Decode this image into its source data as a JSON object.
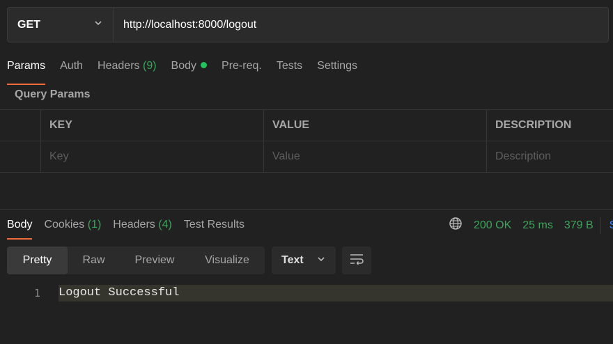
{
  "request": {
    "method": "GET",
    "url": "http://localhost:8000/logout"
  },
  "request_tabs": [
    {
      "label": "Params",
      "active": true
    },
    {
      "label": "Auth"
    },
    {
      "label": "Headers",
      "count": "(9)"
    },
    {
      "label": "Body",
      "dot": true
    },
    {
      "label": "Pre-req."
    },
    {
      "label": "Tests"
    },
    {
      "label": "Settings"
    }
  ],
  "query_params": {
    "title": "Query Params",
    "columns": [
      "KEY",
      "VALUE",
      "DESCRIPTION"
    ],
    "placeholders": [
      "Key",
      "Value",
      "Description"
    ]
  },
  "response_tabs": [
    {
      "label": "Body",
      "active": true
    },
    {
      "label": "Cookies",
      "count": "(1)"
    },
    {
      "label": "Headers",
      "count": "(4)"
    },
    {
      "label": "Test Results"
    }
  ],
  "status": {
    "code": "200 OK",
    "time": "25 ms",
    "size": "379 B",
    "save_label": "S"
  },
  "view_modes": [
    "Pretty",
    "Raw",
    "Preview",
    "Visualize"
  ],
  "format": "Text",
  "response_body": {
    "line_number": "1",
    "text": "Logout Successful"
  },
  "colors": {
    "accent": "#f26b3a",
    "success": "#3ba55c",
    "background": "#212121"
  },
  "icons": [
    "chevron-down-icon",
    "globe-icon",
    "wrap-lines-icon"
  ]
}
